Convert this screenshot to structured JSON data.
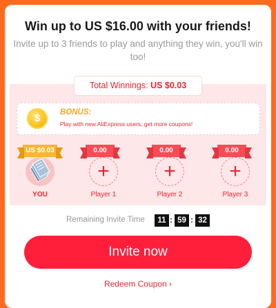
{
  "header": {
    "title": "Win up to US $16.00 with your friends!",
    "subtitle": "Invite up to 3 friends to play and anything they win, you'll win too!"
  },
  "winnings": {
    "label": "Total Winnings:",
    "amount": "US $0.03"
  },
  "bonus": {
    "coin_symbol": "$",
    "title": "BONUS:",
    "description": "Play with new AliExpress users, get more coupons!"
  },
  "players": [
    {
      "name": "YOU",
      "amount": "US $0.03",
      "filled": true
    },
    {
      "name": "Player 1",
      "amount": "0.00",
      "filled": false
    },
    {
      "name": "Player 2",
      "amount": "0.00",
      "filled": false
    },
    {
      "name": "Player 3",
      "amount": "0.00",
      "filled": false
    }
  ],
  "timer": {
    "label": "Remaining Invite Time",
    "hours": "11",
    "minutes": "59",
    "seconds": "32",
    "separator": ":"
  },
  "actions": {
    "invite_label": "Invite now",
    "redeem_label": "Redeem Coupon",
    "redeem_chevron": "›"
  },
  "colors": {
    "background": "#ff6a1f",
    "accent_red": "#e8262c",
    "button_red": "#ff1f3a",
    "gold": "#f7b733",
    "panel_pink": "#fde7e8"
  },
  "icons": {
    "coin": "coin-icon",
    "plus": "plus-icon",
    "you_avatar": "money-avatar-icon",
    "chevron": "chevron-right-icon"
  }
}
